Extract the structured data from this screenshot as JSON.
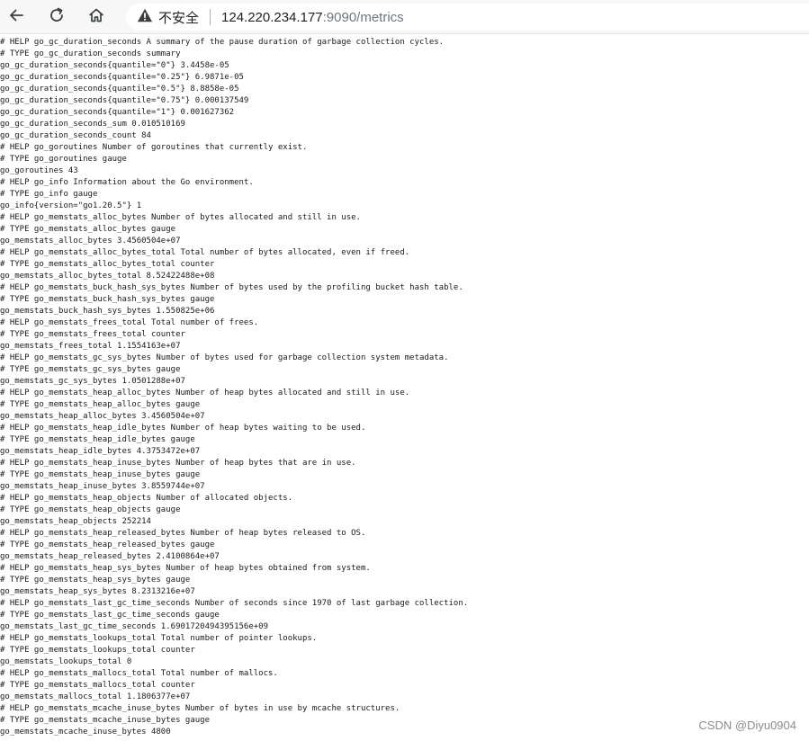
{
  "browser": {
    "security_label": "不安全",
    "url_host": "124.220.234.177",
    "url_rest": ":9090/metrics",
    "icons": [
      "back-icon",
      "reload-icon",
      "home-icon",
      "warning-icon"
    ]
  },
  "lines": [
    "# HELP go_gc_duration_seconds A summary of the pause duration of garbage collection cycles.",
    "# TYPE go_gc_duration_seconds summary",
    "go_gc_duration_seconds{quantile=\"0\"} 3.4458e-05",
    "go_gc_duration_seconds{quantile=\"0.25\"} 6.9871e-05",
    "go_gc_duration_seconds{quantile=\"0.5\"} 8.8858e-05",
    "go_gc_duration_seconds{quantile=\"0.75\"} 0.000137549",
    "go_gc_duration_seconds{quantile=\"1\"} 0.001627362",
    "go_gc_duration_seconds_sum 0.010510169",
    "go_gc_duration_seconds_count 84",
    "# HELP go_goroutines Number of goroutines that currently exist.",
    "# TYPE go_goroutines gauge",
    "go_goroutines 43",
    "# HELP go_info Information about the Go environment.",
    "# TYPE go_info gauge",
    "go_info{version=\"go1.20.5\"} 1",
    "# HELP go_memstats_alloc_bytes Number of bytes allocated and still in use.",
    "# TYPE go_memstats_alloc_bytes gauge",
    "go_memstats_alloc_bytes 3.4560504e+07",
    "# HELP go_memstats_alloc_bytes_total Total number of bytes allocated, even if freed.",
    "# TYPE go_memstats_alloc_bytes_total counter",
    "go_memstats_alloc_bytes_total 8.52422488e+08",
    "# HELP go_memstats_buck_hash_sys_bytes Number of bytes used by the profiling bucket hash table.",
    "# TYPE go_memstats_buck_hash_sys_bytes gauge",
    "go_memstats_buck_hash_sys_bytes 1.550825e+06",
    "# HELP go_memstats_frees_total Total number of frees.",
    "# TYPE go_memstats_frees_total counter",
    "go_memstats_frees_total 1.1554163e+07",
    "# HELP go_memstats_gc_sys_bytes Number of bytes used for garbage collection system metadata.",
    "# TYPE go_memstats_gc_sys_bytes gauge",
    "go_memstats_gc_sys_bytes 1.0501288e+07",
    "# HELP go_memstats_heap_alloc_bytes Number of heap bytes allocated and still in use.",
    "# TYPE go_memstats_heap_alloc_bytes gauge",
    "go_memstats_heap_alloc_bytes 3.4560504e+07",
    "# HELP go_memstats_heap_idle_bytes Number of heap bytes waiting to be used.",
    "# TYPE go_memstats_heap_idle_bytes gauge",
    "go_memstats_heap_idle_bytes 4.3753472e+07",
    "# HELP go_memstats_heap_inuse_bytes Number of heap bytes that are in use.",
    "# TYPE go_memstats_heap_inuse_bytes gauge",
    "go_memstats_heap_inuse_bytes 3.8559744e+07",
    "# HELP go_memstats_heap_objects Number of allocated objects.",
    "# TYPE go_memstats_heap_objects gauge",
    "go_memstats_heap_objects 252214",
    "# HELP go_memstats_heap_released_bytes Number of heap bytes released to OS.",
    "# TYPE go_memstats_heap_released_bytes gauge",
    "go_memstats_heap_released_bytes 2.4100864e+07",
    "# HELP go_memstats_heap_sys_bytes Number of heap bytes obtained from system.",
    "# TYPE go_memstats_heap_sys_bytes gauge",
    "go_memstats_heap_sys_bytes 8.2313216e+07",
    "# HELP go_memstats_last_gc_time_seconds Number of seconds since 1970 of last garbage collection.",
    "# TYPE go_memstats_last_gc_time_seconds gauge",
    "go_memstats_last_gc_time_seconds 1.6901720494395156e+09",
    "# HELP go_memstats_lookups_total Total number of pointer lookups.",
    "# TYPE go_memstats_lookups_total counter",
    "go_memstats_lookups_total 0",
    "# HELP go_memstats_mallocs_total Total number of mallocs.",
    "# TYPE go_memstats_mallocs_total counter",
    "go_memstats_mallocs_total 1.1806377e+07",
    "# HELP go_memstats_mcache_inuse_bytes Number of bytes in use by mcache structures.",
    "# TYPE go_memstats_mcache_inuse_bytes gauge",
    "go_memstats_mcache_inuse_bytes 4800"
  ],
  "watermark": "CSDN @Diyu0904"
}
